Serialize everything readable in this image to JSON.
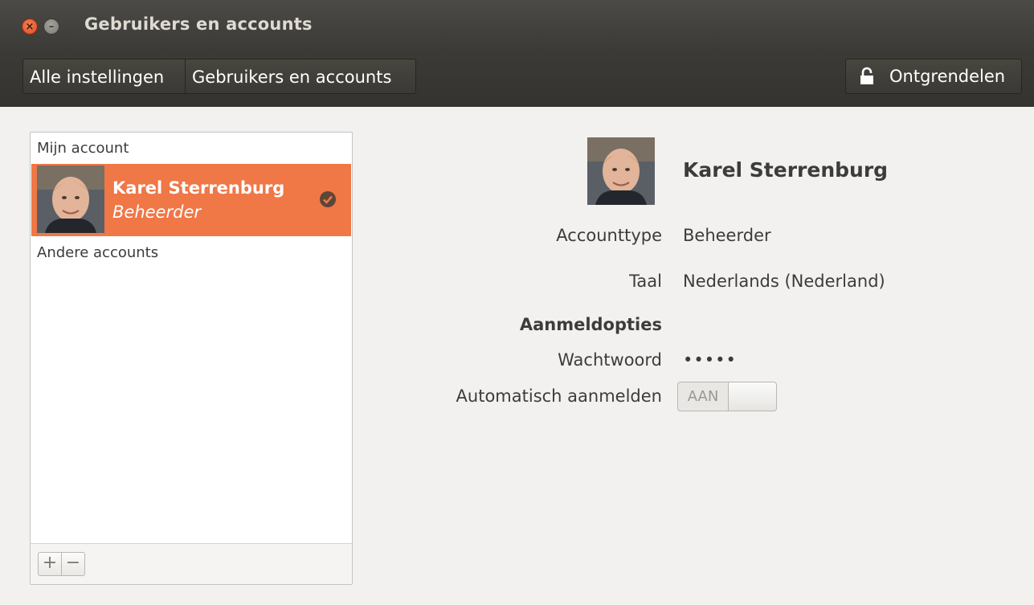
{
  "window": {
    "title": "Gebruikers en accounts",
    "close_icon": "close-icon",
    "minimize_icon": "minimize-icon"
  },
  "toolbar": {
    "breadcrumbs": [
      "Alle instellingen",
      "Gebruikers en accounts"
    ],
    "unlock_label": "Ontgrendelen",
    "unlock_icon": "lock-icon"
  },
  "sidebar": {
    "my_account_header": "Mijn account",
    "other_accounts_header": "Andere accounts",
    "selected_account": {
      "name": "Karel Sterrenburg",
      "role": "Beheerder",
      "status_icon": "check-icon"
    },
    "add_label": "+",
    "remove_label": "−"
  },
  "details": {
    "name": "Karel Sterrenburg",
    "account_type_label": "Accounttype",
    "account_type_value": "Beheerder",
    "language_label": "Taal",
    "language_value": "Nederlands (Nederland)",
    "login_options_header": "Aanmeldopties",
    "password_label": "Wachtwoord",
    "password_value": "•••••",
    "auto_login_label": "Automatisch aanmelden",
    "auto_login_toggle_text": "AAN"
  },
  "colors": {
    "selection": "#f07746",
    "titlebar": "#3c3b37",
    "background": "#f2f1f0"
  }
}
